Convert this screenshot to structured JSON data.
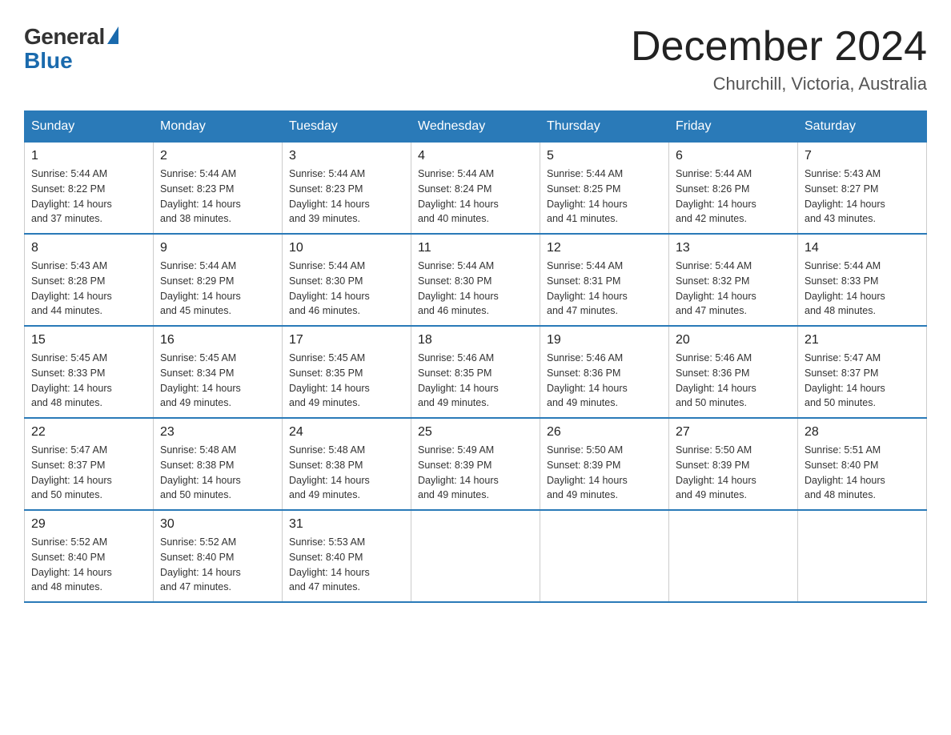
{
  "logo": {
    "general": "General",
    "blue": "Blue"
  },
  "title": "December 2024",
  "location": "Churchill, Victoria, Australia",
  "headers": [
    "Sunday",
    "Monday",
    "Tuesday",
    "Wednesday",
    "Thursday",
    "Friday",
    "Saturday"
  ],
  "weeks": [
    [
      {
        "day": "1",
        "sunrise": "5:44 AM",
        "sunset": "8:22 PM",
        "daylight": "14 hours and 37 minutes."
      },
      {
        "day": "2",
        "sunrise": "5:44 AM",
        "sunset": "8:23 PM",
        "daylight": "14 hours and 38 minutes."
      },
      {
        "day": "3",
        "sunrise": "5:44 AM",
        "sunset": "8:23 PM",
        "daylight": "14 hours and 39 minutes."
      },
      {
        "day": "4",
        "sunrise": "5:44 AM",
        "sunset": "8:24 PM",
        "daylight": "14 hours and 40 minutes."
      },
      {
        "day": "5",
        "sunrise": "5:44 AM",
        "sunset": "8:25 PM",
        "daylight": "14 hours and 41 minutes."
      },
      {
        "day": "6",
        "sunrise": "5:44 AM",
        "sunset": "8:26 PM",
        "daylight": "14 hours and 42 minutes."
      },
      {
        "day": "7",
        "sunrise": "5:43 AM",
        "sunset": "8:27 PM",
        "daylight": "14 hours and 43 minutes."
      }
    ],
    [
      {
        "day": "8",
        "sunrise": "5:43 AM",
        "sunset": "8:28 PM",
        "daylight": "14 hours and 44 minutes."
      },
      {
        "day": "9",
        "sunrise": "5:44 AM",
        "sunset": "8:29 PM",
        "daylight": "14 hours and 45 minutes."
      },
      {
        "day": "10",
        "sunrise": "5:44 AM",
        "sunset": "8:30 PM",
        "daylight": "14 hours and 46 minutes."
      },
      {
        "day": "11",
        "sunrise": "5:44 AM",
        "sunset": "8:30 PM",
        "daylight": "14 hours and 46 minutes."
      },
      {
        "day": "12",
        "sunrise": "5:44 AM",
        "sunset": "8:31 PM",
        "daylight": "14 hours and 47 minutes."
      },
      {
        "day": "13",
        "sunrise": "5:44 AM",
        "sunset": "8:32 PM",
        "daylight": "14 hours and 47 minutes."
      },
      {
        "day": "14",
        "sunrise": "5:44 AM",
        "sunset": "8:33 PM",
        "daylight": "14 hours and 48 minutes."
      }
    ],
    [
      {
        "day": "15",
        "sunrise": "5:45 AM",
        "sunset": "8:33 PM",
        "daylight": "14 hours and 48 minutes."
      },
      {
        "day": "16",
        "sunrise": "5:45 AM",
        "sunset": "8:34 PM",
        "daylight": "14 hours and 49 minutes."
      },
      {
        "day": "17",
        "sunrise": "5:45 AM",
        "sunset": "8:35 PM",
        "daylight": "14 hours and 49 minutes."
      },
      {
        "day": "18",
        "sunrise": "5:46 AM",
        "sunset": "8:35 PM",
        "daylight": "14 hours and 49 minutes."
      },
      {
        "day": "19",
        "sunrise": "5:46 AM",
        "sunset": "8:36 PM",
        "daylight": "14 hours and 49 minutes."
      },
      {
        "day": "20",
        "sunrise": "5:46 AM",
        "sunset": "8:36 PM",
        "daylight": "14 hours and 50 minutes."
      },
      {
        "day": "21",
        "sunrise": "5:47 AM",
        "sunset": "8:37 PM",
        "daylight": "14 hours and 50 minutes."
      }
    ],
    [
      {
        "day": "22",
        "sunrise": "5:47 AM",
        "sunset": "8:37 PM",
        "daylight": "14 hours and 50 minutes."
      },
      {
        "day": "23",
        "sunrise": "5:48 AM",
        "sunset": "8:38 PM",
        "daylight": "14 hours and 50 minutes."
      },
      {
        "day": "24",
        "sunrise": "5:48 AM",
        "sunset": "8:38 PM",
        "daylight": "14 hours and 49 minutes."
      },
      {
        "day": "25",
        "sunrise": "5:49 AM",
        "sunset": "8:39 PM",
        "daylight": "14 hours and 49 minutes."
      },
      {
        "day": "26",
        "sunrise": "5:50 AM",
        "sunset": "8:39 PM",
        "daylight": "14 hours and 49 minutes."
      },
      {
        "day": "27",
        "sunrise": "5:50 AM",
        "sunset": "8:39 PM",
        "daylight": "14 hours and 49 minutes."
      },
      {
        "day": "28",
        "sunrise": "5:51 AM",
        "sunset": "8:40 PM",
        "daylight": "14 hours and 48 minutes."
      }
    ],
    [
      {
        "day": "29",
        "sunrise": "5:52 AM",
        "sunset": "8:40 PM",
        "daylight": "14 hours and 48 minutes."
      },
      {
        "day": "30",
        "sunrise": "5:52 AM",
        "sunset": "8:40 PM",
        "daylight": "14 hours and 47 minutes."
      },
      {
        "day": "31",
        "sunrise": "5:53 AM",
        "sunset": "8:40 PM",
        "daylight": "14 hours and 47 minutes."
      },
      null,
      null,
      null,
      null
    ]
  ],
  "labels": {
    "sunrise": "Sunrise:",
    "sunset": "Sunset:",
    "daylight": "Daylight:"
  }
}
